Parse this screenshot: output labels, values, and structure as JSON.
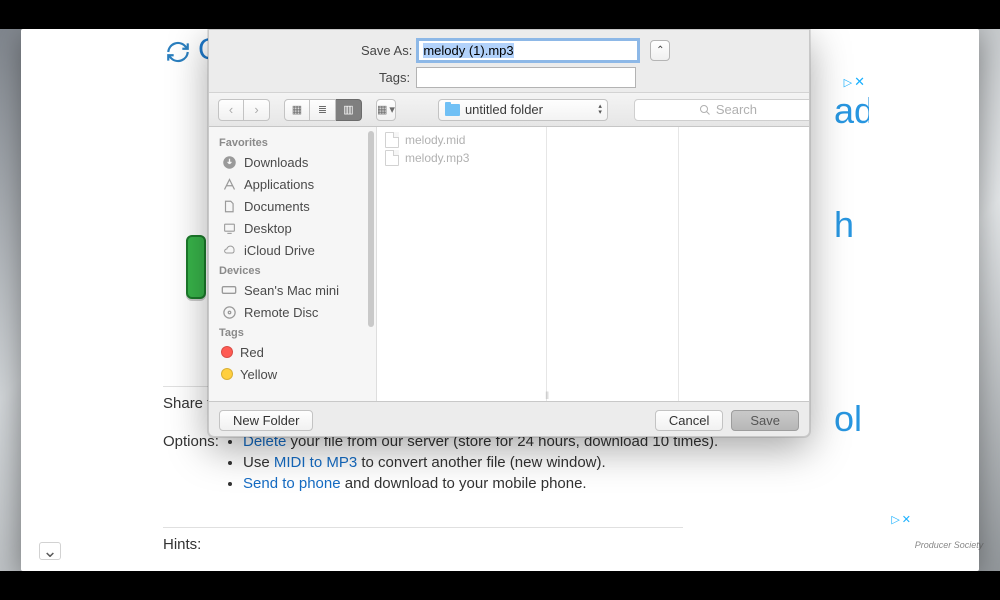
{
  "page": {
    "logo_letter": "C",
    "share_label": "Share to",
    "options_label": "Options:",
    "hints_label": "Hints:",
    "option_delete_link": "Delete",
    "option_delete_rest": " your file from our server (store for 24 hours, download 10 times).",
    "option_use": "Use ",
    "option_midimp3_link": "MIDI to MP3",
    "option_midimp3_rest": " to convert another file (new window).",
    "option_sendphone_link": "Send to phone",
    "option_sendphone_rest": " and download to your mobile phone.",
    "ad_glyph": "▷",
    "ad_x": "✕",
    "side_ad_1": "ad",
    "side_ad_2": "h",
    "side_ad_3": "ol"
  },
  "dialog": {
    "save_as_label": "Save As:",
    "save_as_value": "melody (1).mp3",
    "tags_label": "Tags:",
    "tags_value": "",
    "collapse_glyph": "⌃",
    "location_name": "untitled folder",
    "search_placeholder": "Search",
    "new_folder": "New Folder",
    "cancel": "Cancel",
    "save": "Save"
  },
  "sidebar": {
    "favorites_header": "Favorites",
    "favorites": [
      "Downloads",
      "Applications",
      "Documents",
      "Desktop",
      "iCloud Drive"
    ],
    "devices_header": "Devices",
    "devices": [
      "Sean's Mac mini",
      "Remote Disc"
    ],
    "tags_header": "Tags",
    "tags": [
      {
        "label": "Red",
        "color": "#ff5b53"
      },
      {
        "label": "Yellow",
        "color": "#ffcf3f"
      }
    ]
  },
  "files": [
    "melody.mid",
    "melody.mp3"
  ],
  "watermark": "Producer Society"
}
